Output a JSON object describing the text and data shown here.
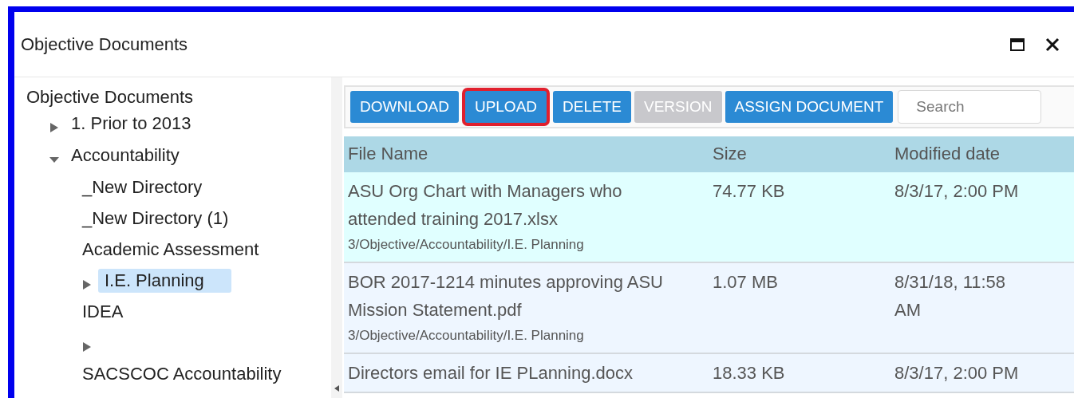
{
  "window": {
    "title": "Objective Documents"
  },
  "tree": {
    "label": "Objective Documents",
    "children": [
      {
        "label": "1. Prior to 2013",
        "kind": "branch",
        "expanded": false,
        "selected": false
      },
      {
        "label": "Accountability",
        "kind": "branch",
        "expanded": true,
        "selected": false,
        "children": [
          {
            "label": "_New Directory",
            "kind": "leaf",
            "selected": false
          },
          {
            "label": "_New Directory (1)",
            "kind": "leaf",
            "selected": false
          },
          {
            "label": "Academic Assessment",
            "kind": "leaf",
            "selected": false
          },
          {
            "label": "I.E. Planning",
            "kind": "branch",
            "expanded": false,
            "selected": true
          },
          {
            "label": "IDEA",
            "kind": "leaf",
            "selected": false
          },
          {
            "kind": "branch",
            "expanded": false,
            "selected": false
          },
          {
            "label": "SACSCOC Accountability",
            "kind": "leaf",
            "selected": false
          }
        ]
      }
    ]
  },
  "toolbar": {
    "buttons": [
      {
        "label": "DOWNLOAD",
        "disabled": false,
        "highlighted": false
      },
      {
        "label": "UPLOAD",
        "disabled": false,
        "highlighted": true
      },
      {
        "label": "DELETE",
        "disabled": false,
        "highlighted": false
      },
      {
        "label": "VERSION",
        "disabled": true,
        "highlighted": false
      },
      {
        "label": "ASSIGN DOCUMENT",
        "disabled": false,
        "highlighted": false
      }
    ],
    "search": {
      "placeholder": "Search"
    }
  },
  "table": {
    "columns": [
      "File Name",
      "Size",
      "Modified date"
    ],
    "rows": [
      {
        "name": "ASU Org Chart with Managers who attended training 2017.xlsx",
        "path": "3/Objective/Accountability/I.E. Planning",
        "size": "74.77 KB",
        "modified": "8/3/17, 2:00 PM",
        "selected": true
      },
      {
        "name": "BOR 2017-1214 minutes approving ASU Mission Statement.pdf",
        "path": "3/Objective/Accountability/I.E. Planning",
        "size": "1.07 MB",
        "modified": "8/31/18, 11:58 AM",
        "selected": false
      },
      {
        "name": "Directors email for IE PLanning.docx",
        "size": "18.33 KB",
        "modified": "8/3/17, 2:00 PM",
        "selected": false
      }
    ]
  }
}
